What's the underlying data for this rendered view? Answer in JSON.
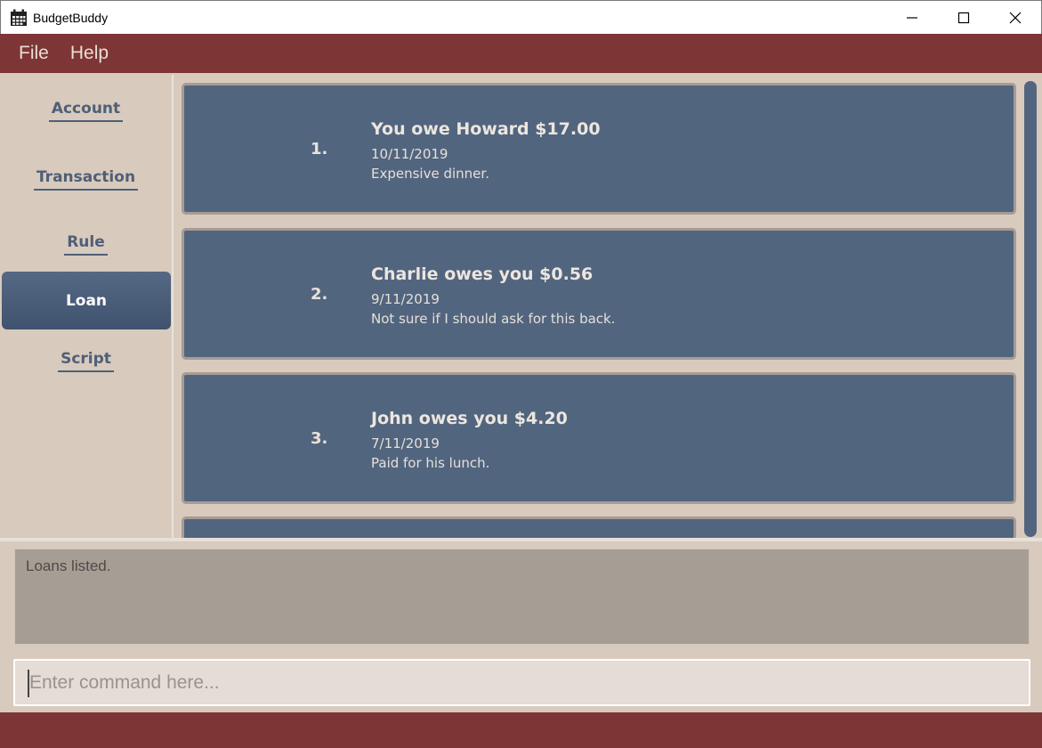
{
  "window": {
    "title": "BudgetBuddy",
    "icon": "calendar-icon",
    "controls": [
      "minimize-icon",
      "maximize-icon",
      "close-icon"
    ]
  },
  "menu": {
    "items": [
      {
        "label": "File"
      },
      {
        "label": "Help"
      }
    ]
  },
  "sidebar": {
    "items": [
      {
        "label": "Account",
        "active": false
      },
      {
        "label": "Transaction",
        "active": false
      },
      {
        "label": "Rule",
        "active": false
      },
      {
        "label": "Loan",
        "active": true
      },
      {
        "label": "Script",
        "active": false
      }
    ]
  },
  "loans": [
    {
      "index": "1.",
      "title": "You owe Howard $17.00",
      "date": "10/11/2019",
      "description": "Expensive dinner."
    },
    {
      "index": "2.",
      "title": "Charlie owes you $0.56",
      "date": "9/11/2019",
      "description": "Not sure if I should ask for this back."
    },
    {
      "index": "3.",
      "title": "John owes you $4.20",
      "date": "7/11/2019",
      "description": "Paid for his lunch."
    }
  ],
  "result": {
    "text": "Loans listed."
  },
  "command": {
    "value": "",
    "placeholder": "Enter command here..."
  },
  "colors": {
    "accent": "#7d3535",
    "card": "#52657f",
    "background": "#d8cabd"
  }
}
